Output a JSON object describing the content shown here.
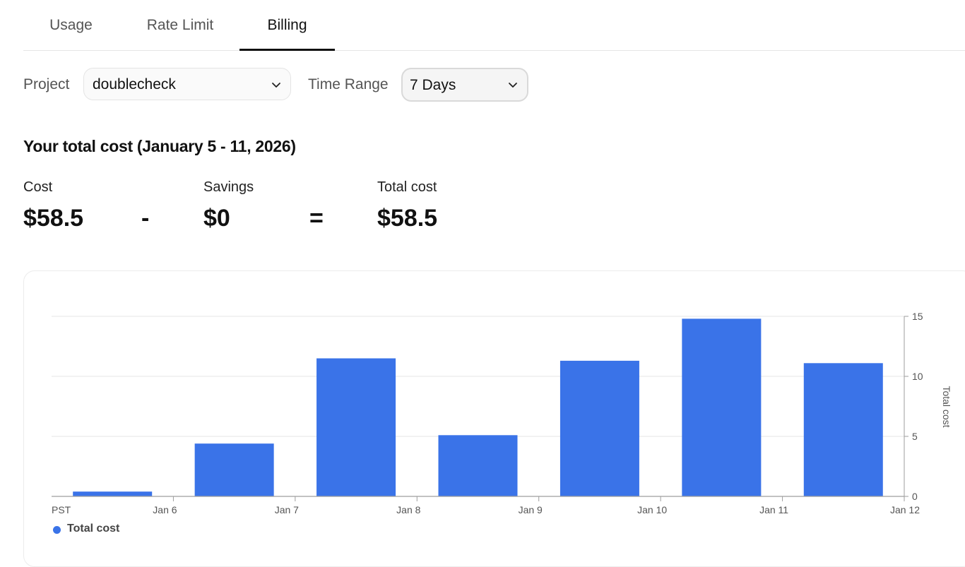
{
  "tabs": [
    {
      "label": "Usage",
      "active": false
    },
    {
      "label": "Rate Limit",
      "active": false
    },
    {
      "label": "Billing",
      "active": true
    }
  ],
  "filters": {
    "project_label": "Project",
    "project_value": "doublecheck",
    "time_range_label": "Time Range",
    "time_range_value": "7 Days"
  },
  "summary": {
    "title": "Your total cost (January 5 - 11, 2026)",
    "cost_label": "Cost",
    "cost_value": "$58.5",
    "minus": "-",
    "savings_label": "Savings",
    "savings_value": "$0",
    "equals": "=",
    "total_label": "Total cost",
    "total_value": "$58.5"
  },
  "colors": {
    "bar": "#3a73e8",
    "grid": "#e6e6e6",
    "axis": "#9e9e9e",
    "tick_text": "#555555"
  },
  "chart_data": {
    "type": "bar",
    "x_tick_labels": [
      "PST",
      "Jan 6",
      "Jan 7",
      "Jan 8",
      "Jan 9",
      "Jan 10",
      "Jan 11",
      "Jan 12"
    ],
    "categories": [
      "Jan 5",
      "Jan 6",
      "Jan 7",
      "Jan 8",
      "Jan 9",
      "Jan 10",
      "Jan 11"
    ],
    "series": [
      {
        "name": "Total cost",
        "values": [
          0.4,
          4.4,
          11.5,
          5.1,
          11.3,
          14.8,
          11.1
        ]
      }
    ],
    "ylabel": "Total cost",
    "y_axis_side": "right",
    "ylim": [
      0,
      15
    ],
    "yticks": [
      0,
      5,
      10,
      15
    ],
    "grid": true,
    "legend_position": "bottom-left"
  }
}
